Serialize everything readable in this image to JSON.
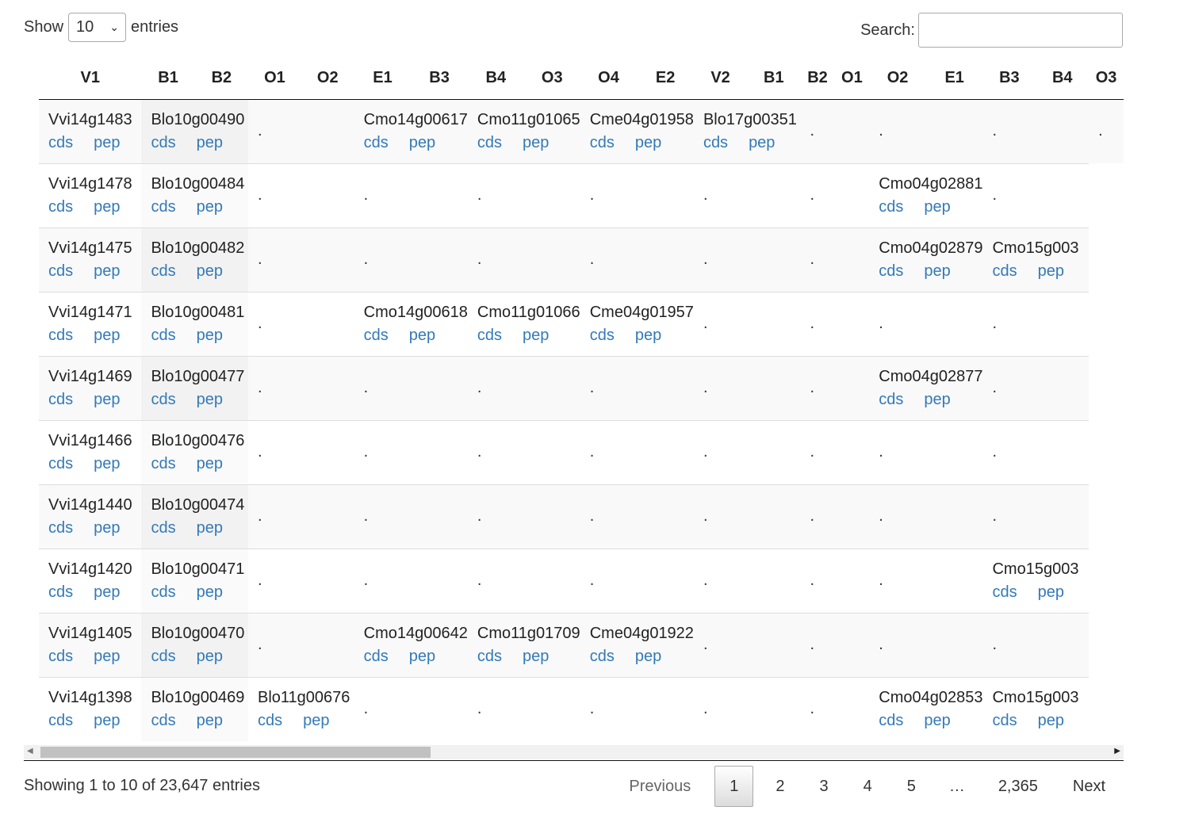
{
  "length_menu": {
    "show_label": "Show",
    "value": "10",
    "entries_label": "entries"
  },
  "search": {
    "label": "Search:",
    "value": ""
  },
  "columns": [
    "V1",
    "B1",
    "B2",
    "O1",
    "O2",
    "E1",
    "B3",
    "B4",
    "O3",
    "O4",
    "E2",
    "V2",
    "B1",
    "B2",
    "O1",
    "O2",
    "E1",
    "B3",
    "B4",
    "O3"
  ],
  "column_widths": [
    131,
    71,
    71,
    71,
    71,
    71,
    71,
    71,
    71,
    71,
    71,
    71,
    71,
    71,
    71,
    71,
    71,
    71,
    71,
    71
  ],
  "link_labels": {
    "cds": "cds",
    "pep": "pep"
  },
  "rows": [
    [
      "Vvi14g1483",
      "Blo10g00490",
      ".",
      "Cmo14g00617",
      "Cmo11g01065",
      "Cme04g01958",
      "Blo17g00351",
      ".",
      ".",
      ".",
      "."
    ],
    [
      "Vvi14g1478",
      "Blo10g00484",
      ".",
      ".",
      ".",
      ".",
      ".",
      ".",
      "Cmo04g02881",
      "."
    ],
    [
      "Vvi14g1475",
      "Blo10g00482",
      ".",
      ".",
      ".",
      ".",
      ".",
      ".",
      "Cmo04g02879",
      "Cmo15g003"
    ],
    [
      "Vvi14g1471",
      "Blo10g00481",
      ".",
      "Cmo14g00618",
      "Cmo11g01066",
      "Cme04g01957",
      ".",
      ".",
      ".",
      "."
    ],
    [
      "Vvi14g1469",
      "Blo10g00477",
      ".",
      ".",
      ".",
      ".",
      ".",
      ".",
      "Cmo04g02877",
      "."
    ],
    [
      "Vvi14g1466",
      "Blo10g00476",
      ".",
      ".",
      ".",
      ".",
      ".",
      ".",
      ".",
      "."
    ],
    [
      "Vvi14g1440",
      "Blo10g00474",
      ".",
      ".",
      ".",
      ".",
      ".",
      ".",
      ".",
      "."
    ],
    [
      "Vvi14g1420",
      "Blo10g00471",
      ".",
      ".",
      ".",
      ".",
      ".",
      ".",
      ".",
      "Cmo15g003"
    ],
    [
      "Vvi14g1405",
      "Blo10g00470",
      ".",
      "Cmo14g00642",
      "Cmo11g01709",
      "Cme04g01922",
      ".",
      ".",
      ".",
      "."
    ],
    [
      "Vvi14g1398",
      "Blo10g00469",
      "Blo11g00676",
      ".",
      ".",
      ".",
      ".",
      ".",
      "Cmo04g02853",
      "Cmo15g003"
    ]
  ],
  "info": "Showing 1 to 10 of 23,647 entries",
  "pagination": {
    "previous": "Previous",
    "pages": [
      "1",
      "2",
      "3",
      "4",
      "5",
      "…",
      "2,365"
    ],
    "current": "1",
    "next": "Next"
  }
}
